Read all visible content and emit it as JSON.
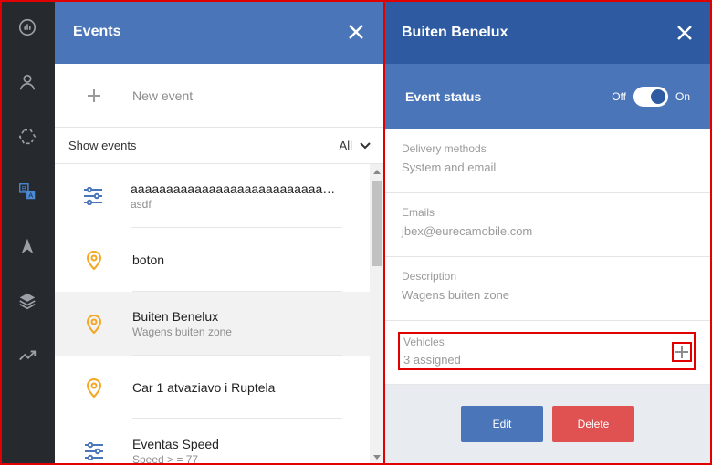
{
  "rail": {
    "items": [
      {
        "icon": "dashboard-icon"
      },
      {
        "icon": "user-icon"
      },
      {
        "icon": "geofence-icon"
      },
      {
        "icon": "events-icon",
        "text_a": "B",
        "text_b": "A"
      },
      {
        "icon": "navigation-icon"
      },
      {
        "icon": "layers-icon"
      },
      {
        "icon": "reports-icon"
      }
    ]
  },
  "events_panel": {
    "title": "Events",
    "new_event_label": "New event",
    "show_events_label": "Show events",
    "filter_value": "All",
    "items": [
      {
        "icon": "sliders-icon",
        "title": "aaaaaaaaaaaaaaaaaaaaaaaaaaaaaaaaaaaaaaa",
        "subtitle": "asdf",
        "selected": false
      },
      {
        "icon": "location-pin-icon",
        "title": "boton",
        "subtitle": "",
        "selected": false
      },
      {
        "icon": "location-pin-icon",
        "title": "Buiten Benelux",
        "subtitle": "Wagens buiten zone",
        "selected": true
      },
      {
        "icon": "location-pin-icon",
        "title": "Car 1 atvaziavo i Ruptela",
        "subtitle": "",
        "selected": false
      },
      {
        "icon": "sliders-icon",
        "title": "Eventas Speed",
        "subtitle": "Speed > = 77",
        "selected": false
      }
    ]
  },
  "detail": {
    "title": "Buiten Benelux",
    "status_label": "Event status",
    "toggle_off": "Off",
    "toggle_on": "On",
    "toggle_state": "on",
    "fields": {
      "delivery": {
        "label": "Delivery methods",
        "value": "System and email"
      },
      "emails": {
        "label": "Emails",
        "value": "jbex@eurecamobile.com"
      },
      "description": {
        "label": "Description",
        "value": "Wagens buiten zone"
      },
      "vehicles": {
        "label": "Vehicles",
        "value": "3 assigned"
      }
    },
    "edit_label": "Edit",
    "delete_label": "Delete"
  },
  "colors": {
    "rail_bg": "#262a2e",
    "header_blue": "#4a76b9",
    "header_dark_blue": "#2d5aa0",
    "pin_orange": "#f5a623",
    "delete_red": "#e05252",
    "highlight_red": "#e00000"
  }
}
